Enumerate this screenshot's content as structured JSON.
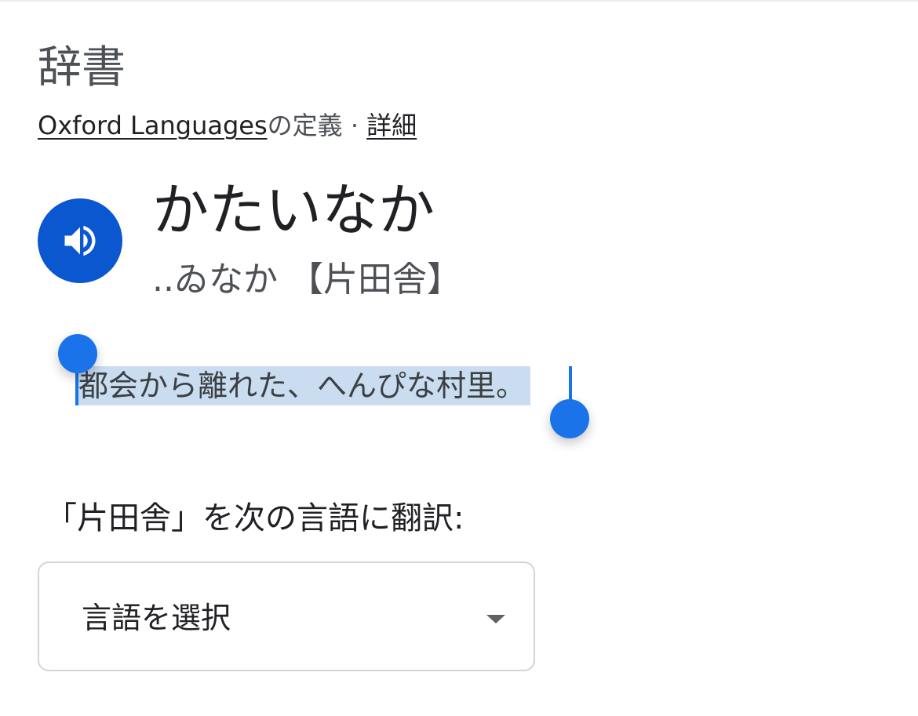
{
  "dictionary": {
    "title": "辞書",
    "source": {
      "provider_link": "Oxford Languages",
      "suffix": "の定義 · ",
      "details_link": "詳細"
    },
    "entry": {
      "headword": "かたいなか",
      "reading": "..ゐなか 【片田舎】",
      "audio_icon": "speaker-icon",
      "definition": "都会から離れた、へんぴな村里。"
    },
    "translate": {
      "label": "「片田舎」を次の言語に翻訳:",
      "select_value": "言語を選択"
    }
  },
  "colors": {
    "accent": "#0b57d0",
    "selection_handle": "#1a73e8",
    "selection_highlight": "#c9dcf0"
  }
}
